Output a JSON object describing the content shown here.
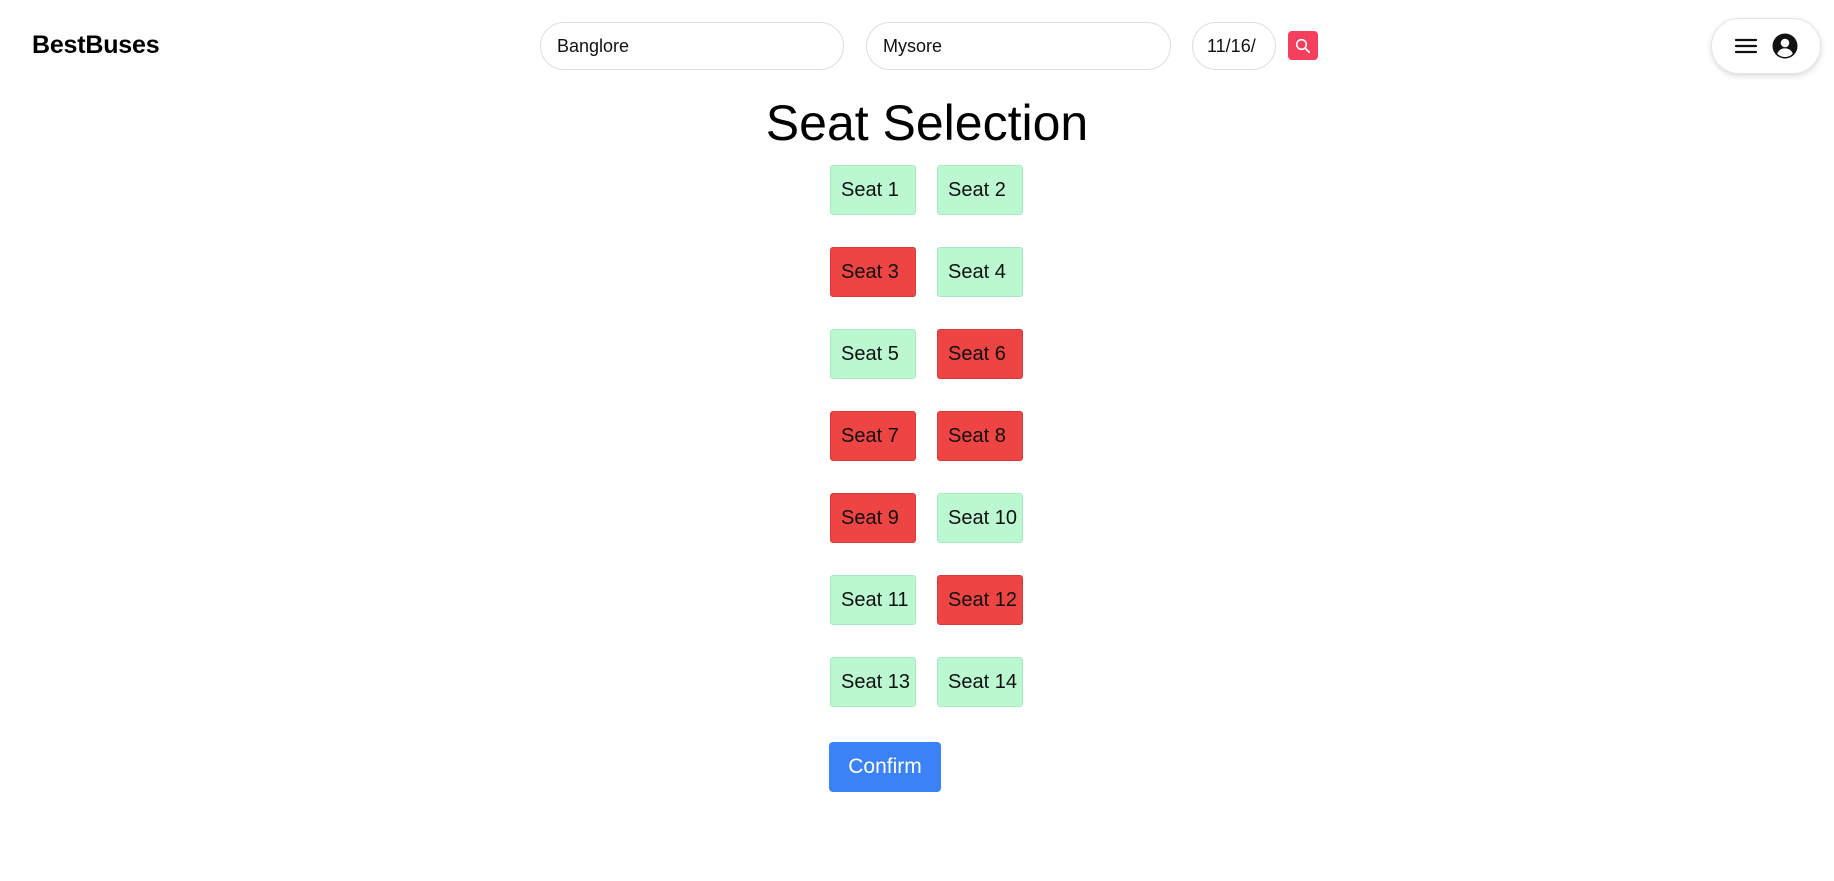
{
  "header": {
    "logo": "BestBuses",
    "search": {
      "from_value": "Banglore",
      "to_value": "Mysore",
      "date_value": "11/16/",
      "search_icon": "search-icon",
      "search_button_color": "#f43f5e"
    },
    "user_menu": {
      "menu_icon": "hamburger-menu-icon",
      "avatar_icon": "user-circle-icon"
    }
  },
  "main": {
    "title": "Seat Selection",
    "seat_colors": {
      "available": "#bbf7d0",
      "booked": "#ef4444"
    },
    "seats": [
      {
        "label": "Seat 1",
        "status": "available"
      },
      {
        "label": "Seat 2",
        "status": "available"
      },
      {
        "label": "Seat 3",
        "status": "booked"
      },
      {
        "label": "Seat 4",
        "status": "available"
      },
      {
        "label": "Seat 5",
        "status": "available"
      },
      {
        "label": "Seat 6",
        "status": "booked"
      },
      {
        "label": "Seat 7",
        "status": "booked"
      },
      {
        "label": "Seat 8",
        "status": "booked"
      },
      {
        "label": "Seat 9",
        "status": "booked"
      },
      {
        "label": "Seat 10",
        "status": "available"
      },
      {
        "label": "Seat 11",
        "status": "available"
      },
      {
        "label": "Seat 12",
        "status": "booked"
      },
      {
        "label": "Seat 13",
        "status": "available"
      },
      {
        "label": "Seat 14",
        "status": "available"
      }
    ],
    "confirm_label": "Confirm",
    "confirm_color": "#3b82f6"
  }
}
